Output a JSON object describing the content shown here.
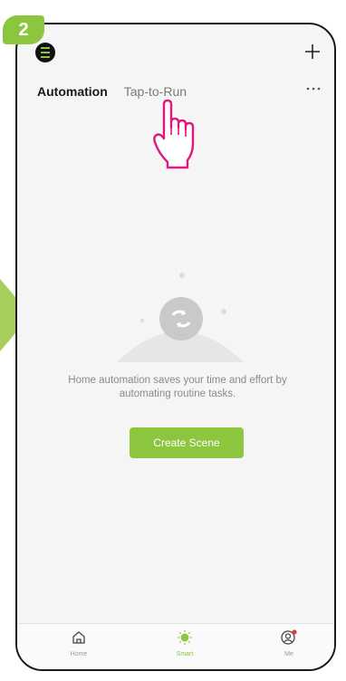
{
  "step": {
    "number": "2"
  },
  "header": {
    "add_icon": "plus-icon",
    "more_icon": "more-horizontal-icon"
  },
  "tabs": [
    {
      "label": "Automation",
      "active": true
    },
    {
      "label": "Tap-to-Run",
      "active": false
    }
  ],
  "empty_state": {
    "message": "Home automation saves your time and effort by automating routine tasks.",
    "button_label": "Create Scene"
  },
  "bottom_nav": [
    {
      "label": "Home",
      "icon": "home-icon"
    },
    {
      "label": "Smart",
      "icon": "smart-sun-icon",
      "active": true
    },
    {
      "label": "Me",
      "icon": "user-icon",
      "badge": true
    }
  ],
  "colors": {
    "accent": "#8cc63f",
    "pointer": "#e0177f",
    "background": "#f5f5f5"
  }
}
